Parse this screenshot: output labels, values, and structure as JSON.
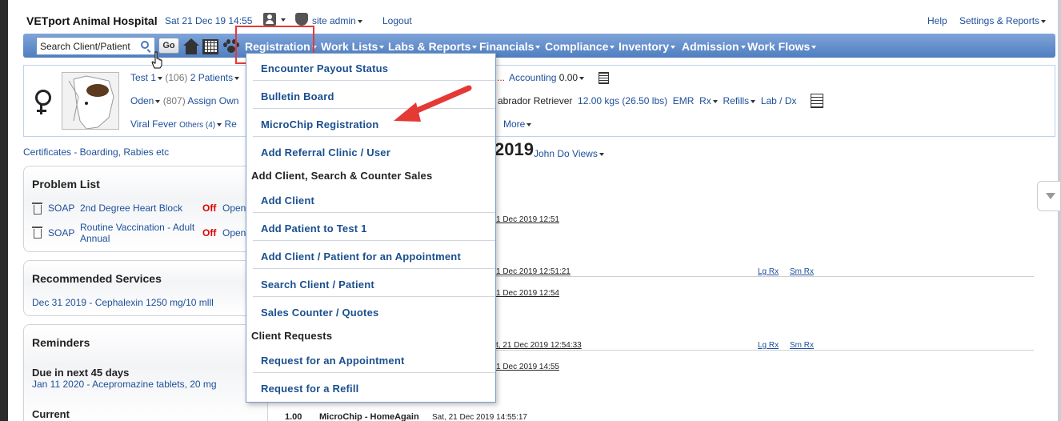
{
  "header": {
    "hospital_name": "VETport Animal Hospital",
    "datetime": "Sat 21 Dec 19 14:55",
    "user": "site admin",
    "logout": "Logout",
    "help": "Help",
    "settings": "Settings & Reports"
  },
  "navbar": {
    "search_placeholder": "Search Client/Patient",
    "go": "Go",
    "menus": [
      "Registration",
      "Work Lists",
      "Labs & Reports",
      "Financials",
      "Compliance",
      "Inventory",
      "Admission",
      "Work Flows"
    ]
  },
  "patient": {
    "client": "Test 1",
    "client_id": "(106)",
    "patients": "2 Patients",
    "accounting_label": "Accounting",
    "accounting_value": "0.00",
    "name": "Oden",
    "patient_id": "(807)",
    "assign": "Assign Own",
    "breed": "abrador Retriever",
    "weight": "12.00 kgs (26.50 lbs)",
    "emr": "EMR",
    "rx": "Rx",
    "refills": "Refills",
    "labdx": "Lab / Dx",
    "problem": "Viral Fever",
    "others": "Others (4)",
    "re": "Re",
    "more": "More",
    "ellipsis": "..."
  },
  "certs": "Certificates - Boarding, Rabies etc",
  "big_date": "2019",
  "views": "John Do Views",
  "problem_list": {
    "title": "Problem List",
    "rows": [
      {
        "type": "SOAP",
        "name": "2nd Degree Heart Block",
        "status": "Off",
        "extra": "Open"
      },
      {
        "type": "SOAP",
        "name_line1": "Routine Vaccination - Adult",
        "name_line2": "Annual",
        "status": "Off",
        "extra": "Open"
      }
    ]
  },
  "recommended": {
    "title": "Recommended Services",
    "item": "Dec 31 2019 - Cephalexin 1250 mg/10 mlll"
  },
  "reminders": {
    "title": "Reminders",
    "due_label": "Due in next 45 days",
    "due_item": "Jan 11 2020 - Acepromazine tablets, 20 mg",
    "current_label": "Current"
  },
  "log": {
    "l1": "1 Dec 2019 12:51",
    "l2": "1 Dec 2019 12:51:21",
    "l3": "1 Dec 2019 12:54",
    "l4": "t, 21 Dec 2019 12:54:33",
    "l5": "1 Dec 2019 14:55",
    "lg_rx": "Lg Rx",
    "sm_rx": "Sm Rx",
    "bottom_qty": "1.00",
    "bottom_name": "MicroChip - HomeAgain",
    "bottom_date": "Sat, 21 Dec 2019 14:55:17"
  },
  "dropdown": {
    "items": [
      {
        "kind": "item",
        "label": "Encounter Payout Status"
      },
      {
        "kind": "item",
        "label": "Bulletin Board"
      },
      {
        "kind": "item",
        "label": "MicroChip Registration"
      },
      {
        "kind": "item",
        "label": "Add Referral Clinic / User"
      },
      {
        "kind": "head",
        "label": "Add Client, Search & Counter Sales"
      },
      {
        "kind": "item",
        "label": "Add Client"
      },
      {
        "kind": "item",
        "label": "Add Patient to Test 1"
      },
      {
        "kind": "item",
        "label": "Add Client / Patient for an Appointment"
      },
      {
        "kind": "item",
        "label": "Search Client / Patient"
      },
      {
        "kind": "item",
        "label": "Sales Counter / Quotes"
      },
      {
        "kind": "head",
        "label": "Client Requests"
      },
      {
        "kind": "item",
        "label": "Request for an Appointment"
      },
      {
        "kind": "item",
        "label": "Request for a Refill"
      }
    ]
  },
  "colors": {
    "nav_top": "#7fa4d8",
    "nav_bottom": "#4f7ec0",
    "link": "#1d4f9a",
    "highlight": "#e53935",
    "off": "#e00000"
  }
}
